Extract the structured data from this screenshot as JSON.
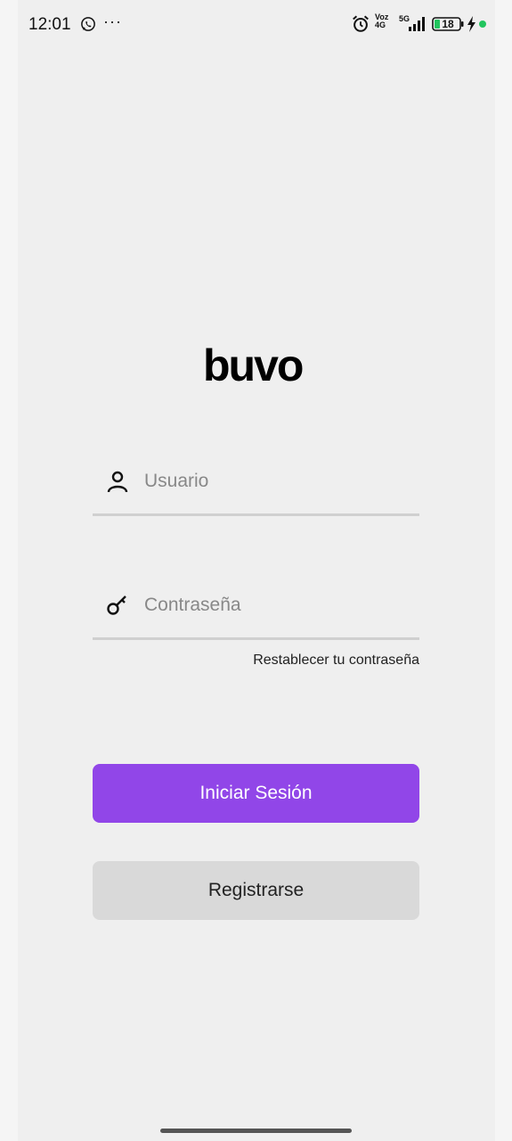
{
  "status_bar": {
    "time": "12:01",
    "more": "···",
    "network_label_top": "Voz",
    "network_label_bottom": "4G",
    "signal_label": "5G",
    "battery_level": "18",
    "icons": [
      "whatsapp-icon",
      "more-icon",
      "alarm-icon",
      "signal-icon",
      "battery-icon",
      "charging-icon",
      "dot-icon"
    ]
  },
  "logo": {
    "text": "buvo"
  },
  "login_form": {
    "username_placeholder": "Usuario",
    "password_placeholder": "Contraseña",
    "reset_password_label": "Restablecer tu contraseña",
    "login_label": "Iniciar Sesión",
    "register_label": "Registrarse"
  },
  "colors": {
    "accent": "#9146e8",
    "secondary_button": "#d9d9d9",
    "background": "#efefef",
    "status_dot": "#22c55e"
  }
}
